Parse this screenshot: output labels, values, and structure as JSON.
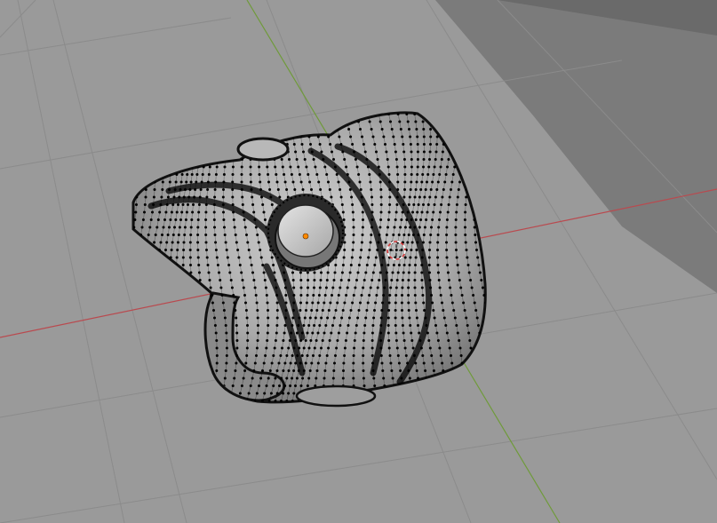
{
  "viewport": {
    "mode": "edit-mode-vertex-select",
    "object": "mesh",
    "colors": {
      "floor": "#9a9a9a",
      "floor_far": "#7a7a7a",
      "background": "#5e5e5e",
      "grid_line": "#8a8a8a",
      "x_axis": "#b94a4f",
      "y_axis": "#6f9a3a",
      "mesh_face": "#bdbdbd",
      "mesh_shadow": "#8e8e8e",
      "vertex": "#000000",
      "origin": "#ff8a00",
      "cursor_red": "#d43a3a",
      "cursor_white": "#ffffff"
    }
  }
}
